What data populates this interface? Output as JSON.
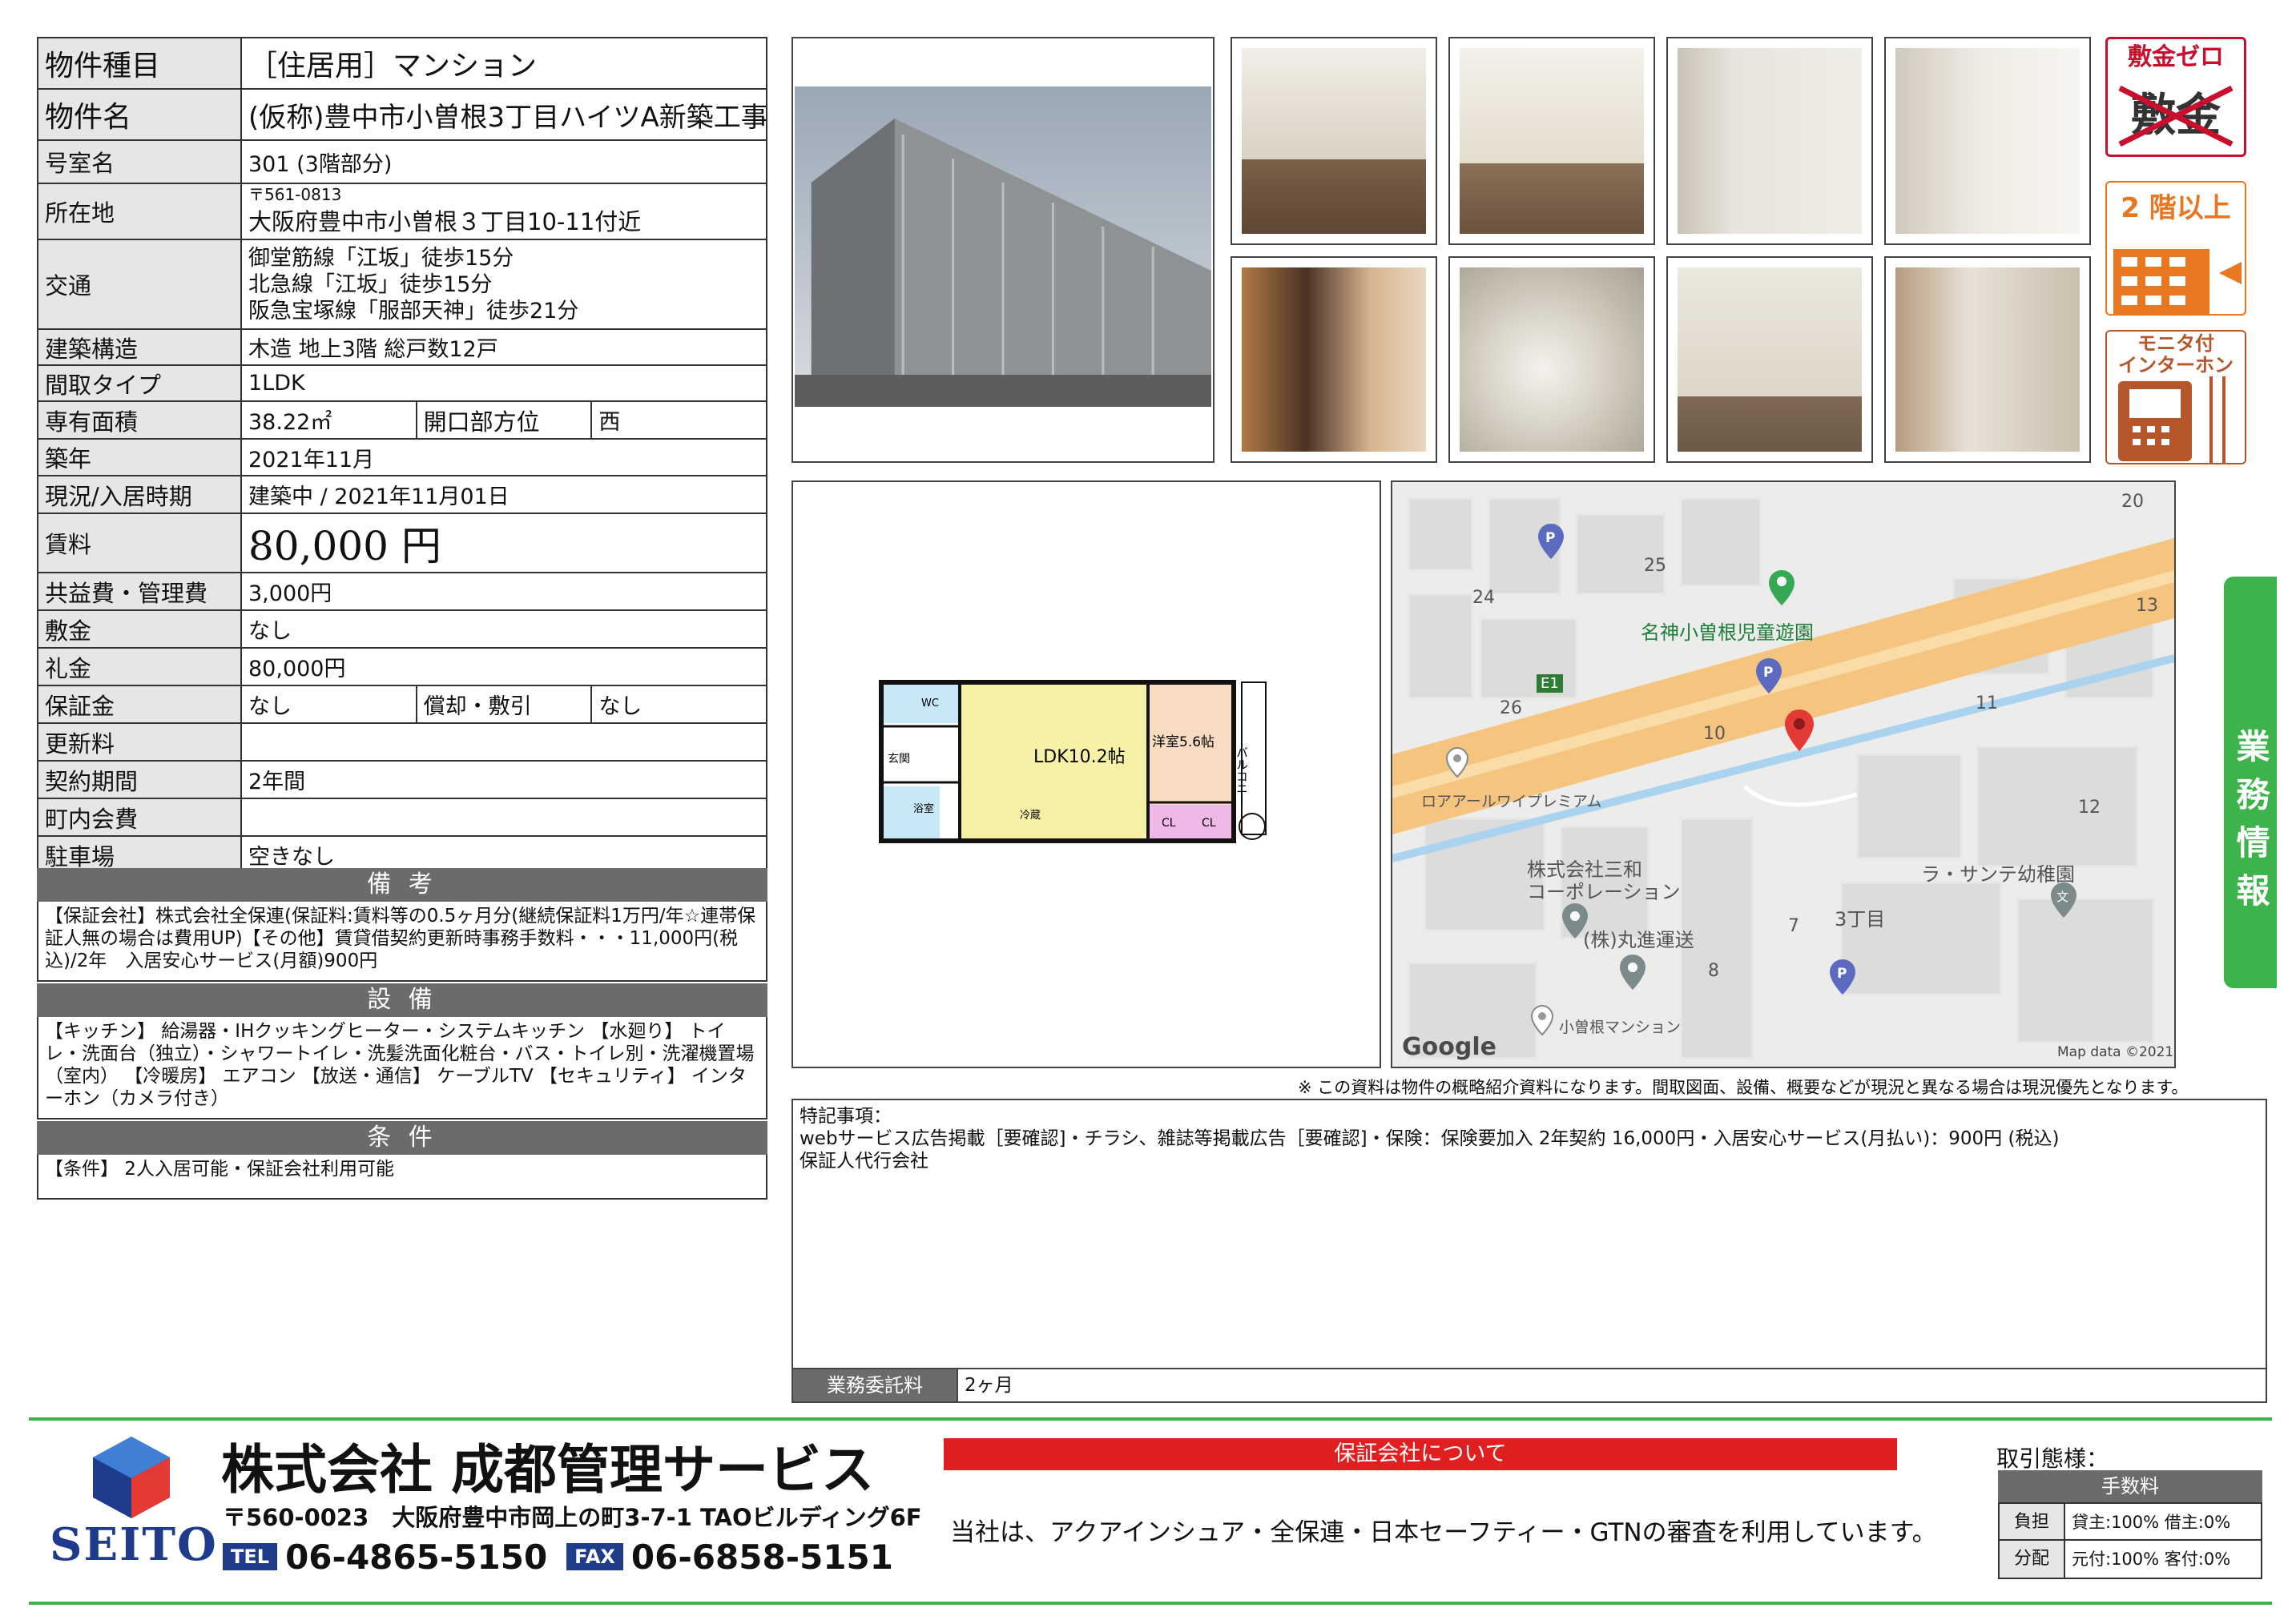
{
  "property": {
    "type_label": "物件種目",
    "type_value": "［住居用］マンション",
    "name_label": "物件名",
    "name_value": "(仮称)豊中市小曽根3丁目ハイツA新築工事",
    "room_label": "号室名",
    "room_value": "301 (3階部分)",
    "address_label": "所在地",
    "postal": "〒561-0813",
    "address": "大阪府豊中市小曽根３丁目10-11付近",
    "transport_label": "交通",
    "transport": [
      "御堂筋線「江坂」徒歩15分",
      "北急線「江坂」徒歩15分",
      "阪急宝塚線「服部天神」徒歩21分"
    ],
    "structure_label": "建築構造",
    "structure": "木造 地上3階 総戸数12戸",
    "layout_label": "間取タイプ",
    "layout": "1LDK",
    "area_label": "専有面積",
    "area": "38.22㎡",
    "direction_label": "開口部方位",
    "direction": "西",
    "built_label": "築年",
    "built": "2021年11月",
    "status_label": "現況/入居時期",
    "status": "建築中 / 2021年11月01日",
    "rent_label": "賃料",
    "rent": "80,000 円",
    "fee_label": "共益費・管理費",
    "fee": "3,000円",
    "deposit_label": "敷金",
    "deposit": "なし",
    "keymoney_label": "礼金",
    "keymoney": "80,000円",
    "guarantee_label": "保証金",
    "guarantee": "なし",
    "amort_label": "償却・敷引",
    "amort": "なし",
    "renewal_label": "更新料",
    "renewal": "",
    "contract_label": "契約期間",
    "contract": "2年間",
    "community_label": "町内会費",
    "community": "",
    "parking_label": "駐車場",
    "parking": "空きなし"
  },
  "remarks": {
    "title": "備 考",
    "body": "【保証会社】株式会社全保連(保証料:賃料等の0.5ヶ月分(継続保証料1万円/年☆連帯保証人無の場合は費用UP)【その他】賃貸借契約更新時事務手数料・・・11,000円(税込)/2年　入居安心サービス(月額)900円"
  },
  "equipment": {
    "title": "設 備",
    "body": "【キッチン】 給湯器・IHクッキングヒーター・システムキッチン 【水廻り】 トイレ・洗面台（独立）・シャワートイレ・洗髪洗面化粧台・バス・トイレ別・洗濯機置場（室内） 【冷暖房】 エアコン 【放送・通信】 ケーブルTV 【セキュリティ】 インターホン（カメラ付き）"
  },
  "conditions": {
    "title": "条 件",
    "body": "【条件】 2人入居可能・保証会社利用可能"
  },
  "badges": {
    "deposit_zero": "敷金ゼロ",
    "deposit_crossed": "敷金",
    "floor2": "2 階以上",
    "intercom": "モニタ付\nインターホン"
  },
  "side_tab": "業務情報",
  "floorplan": {
    "ldk": "LDK10.2帖",
    "western": "洋室5.6帖",
    "balcony": "バルコニー",
    "cl": "CL",
    "entrance": "玄関",
    "wc": "WC",
    "bath": "浴室",
    "fridge": "冷蔵"
  },
  "map": {
    "park": "名神小曽根児童遊園",
    "e1": "E1",
    "n20": "20",
    "n25": "25",
    "n24": "24",
    "n26": "26",
    "n13": "13",
    "n11": "11",
    "n10": "10",
    "n12": "12",
    "n7": "7",
    "n8": "8",
    "loa": "ロアアールワイプレミアム",
    "sanwa": "株式会社三和\nコーポレーション",
    "marushin": "(株)丸進運送",
    "kindergarten": "ラ・サンテ幼稚園",
    "chome": "3丁目",
    "ozone": "小曽根マンション",
    "google": "Google",
    "mapdata": "Map data ©2021"
  },
  "disclaimer": "※ この資料は物件の概略紹介資料になります。間取図面、設備、概要などが現況と異なる場合は現況優先となります。",
  "notes": {
    "title": "特記事項：",
    "line1": "webサービス広告掲載［要確認]・チラシ、雑誌等掲載広告［要確認]・保険：保険要加入 2年契約 16,000円・入居安心サービス(月払い)：900円 (税込)",
    "line2": "保証人代行会社"
  },
  "commission": {
    "label": "業務委託料",
    "value": "2ヶ月"
  },
  "company": {
    "logo_text": "SEITO",
    "name": "株式会社 成都管理サービス",
    "address": "〒560-0023　大阪府豊中市岡上の町3-7-1 TAOビルディング6F",
    "tel_label": "TEL",
    "tel": "06-4865-5150",
    "fax_label": "FAX",
    "fax": "06-6858-5151",
    "guarantee_banner": "保証会社について",
    "guarantee_text": "当社は、アクアインシュア・全保連・日本セーフティー・GTNの審査を利用しています。"
  },
  "transaction": {
    "title": "取引態様：",
    "fee_header": "手数料",
    "burden_label": "負担",
    "burden": "貸主:100% 借主:0%",
    "split_label": "分配",
    "split": "元付:100% 客付:0%"
  },
  "colors": {
    "accent_red": "#c8102e",
    "green_tab": "#3cb44b",
    "orange": "#e87722",
    "header_gray": "#6b6b6b"
  }
}
